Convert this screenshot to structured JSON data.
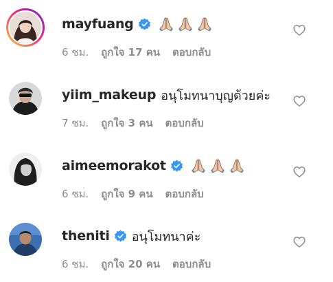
{
  "comments": [
    {
      "username": "mayfuang",
      "verified": true,
      "text": "",
      "emoji": [
        "folded-hands",
        "folded-hands",
        "folded-hands"
      ],
      "time": "6 ชม.",
      "likes": "ถูกใจ 17 คน",
      "reply": "ตอบกลับ"
    },
    {
      "username": "yiim_makeup",
      "verified": false,
      "text": "อนุโมทนาบุญด้วยค่ะ",
      "emoji": [],
      "time": "7 ชม.",
      "likes": "ถูกใจ 3 คน",
      "reply": "ตอบกลับ"
    },
    {
      "username": "aimeemorakot",
      "verified": true,
      "text": "",
      "emoji": [
        "folded-hands",
        "folded-hands",
        "folded-hands"
      ],
      "time": "6 ชม.",
      "likes": "ถูกใจ 9 คน",
      "reply": "ตอบกลับ"
    },
    {
      "username": "theniti",
      "verified": true,
      "text": "อนุโมทนาค่ะ",
      "emoji": [],
      "time": "6 ชม.",
      "likes": "ถูกใจ 20 คน",
      "reply": "ตอบกลับ"
    }
  ],
  "colors": {
    "text": "#262626",
    "secondary": "#8e8e8e",
    "verified": "#3897f0",
    "heart_outline": "#8e8e8e"
  },
  "icons": {
    "verified": "verified-badge-icon",
    "like": "heart-outline-icon",
    "emoji": "folded-hands-emoji"
  }
}
